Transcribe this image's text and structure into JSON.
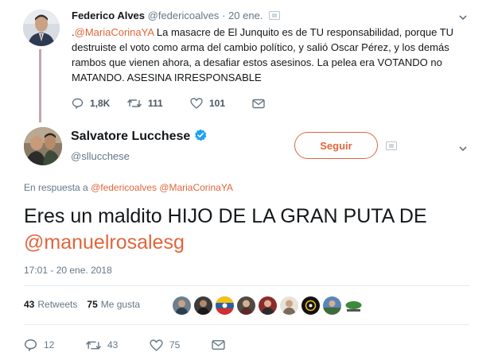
{
  "parent_tweet": {
    "name": "Federico Alves",
    "handle": "@federicoalves",
    "separator": "·",
    "date": "20 ene.",
    "text_prefix": ".",
    "mention": "@MariaCorinaYA",
    "text": " La masacre de El Junquito es de TU responsabilidad, porque TU destruiste el voto como arma del cambio político, y salió Oscar Pérez, y los demás rambos que vienen ahora, a desafiar estos asesinos. La pelea era VOTANDO no MATANDO. ASESINA IRRESPONSABLE",
    "replies": "1,8K",
    "retweets": "111",
    "likes": "101"
  },
  "main_tweet": {
    "name": "Salvatore Lucchese",
    "handle": "@sllucchese",
    "follow_label": "Seguir",
    "reply_prefix": "En respuesta a ",
    "reply_mentions": "@federicoalves @MariaCorinaYA",
    "text": "Eres un maldito HIJO DE LA GRAN PUTA DE ",
    "text_mention": "@manuelrosalesg",
    "timestamp": "17:01 - 20 ene. 2018",
    "retweets_count": "43",
    "retweets_label": "Retweets",
    "likes_count": "75",
    "likes_label": "Me gusta",
    "replies": "12",
    "retweets": "43",
    "likes": "75"
  },
  "colors": {
    "accent": "#e0663c",
    "muted": "#657786",
    "verified": "#1da1f2"
  }
}
